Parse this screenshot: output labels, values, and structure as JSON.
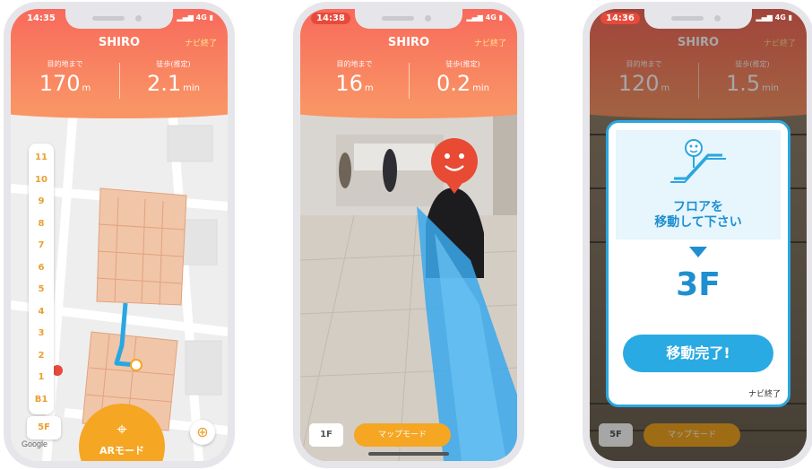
{
  "phones": [
    {
      "time": "14:35",
      "header": {
        "title": "SHIRO",
        "end_nav": "ナビ終了",
        "distance_label": "目的地まで",
        "distance_value": "170",
        "distance_unit": "m",
        "walk_label": "徒歩(推定)",
        "walk_value": "2.1",
        "walk_unit": "min"
      },
      "floors": [
        "11",
        "10",
        "9",
        "8",
        "7",
        "6",
        "5",
        "4",
        "3",
        "2",
        "1",
        "B1"
      ],
      "current_floor_button": "5F",
      "ar_button": "ARモード",
      "google": "Google"
    },
    {
      "time": "14:38",
      "header": {
        "title": "SHIRO",
        "end_nav": "ナビ終了",
        "distance_label": "目的地まで",
        "distance_value": "16",
        "distance_unit": "m",
        "walk_label": "徒歩(推定)",
        "walk_value": "0.2",
        "walk_unit": "min"
      },
      "floor_button": "1F",
      "map_mode_button": "マップモード"
    },
    {
      "time": "14:36",
      "header": {
        "title": "SHIRO",
        "end_nav": "ナビ終了",
        "distance_label": "目的地まで",
        "distance_value": "120",
        "distance_unit": "m",
        "walk_label": "徒歩(推定)",
        "walk_value": "1.5",
        "walk_unit": "min"
      },
      "floor_button": "5F",
      "map_mode_button": "マップモード",
      "modal": {
        "message_line1": "フロアを",
        "message_line2": "移動して下さい",
        "target_floor": "3F",
        "done_button": "移動完了!",
        "end_nav": "ナビ終了"
      }
    }
  ],
  "signal": "4G",
  "colors": {
    "header": "#f86a5c",
    "accent_orange": "#f5a623",
    "accent_blue": "#29a7e1"
  }
}
